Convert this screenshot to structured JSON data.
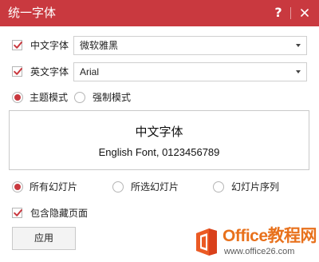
{
  "window": {
    "title": "统一字体",
    "help_label": "?",
    "close_icon": "close-icon"
  },
  "colors": {
    "accent": "#c9393f",
    "watermark_orange": "#e8711c"
  },
  "chinese_font": {
    "checked": true,
    "label": "中文字体",
    "value": "微软雅黑"
  },
  "english_font": {
    "checked": true,
    "label": "英文字体",
    "value": "Arial"
  },
  "mode": {
    "options": [
      {
        "label": "主题模式",
        "checked": true
      },
      {
        "label": "强制模式",
        "checked": false
      }
    ]
  },
  "preview": {
    "chinese_text": "中文字体",
    "english_text": "English Font, 0123456789"
  },
  "scope": {
    "options": [
      {
        "label": "所有幻灯片",
        "checked": true
      },
      {
        "label": "所选幻灯片",
        "checked": false
      },
      {
        "label": "幻灯片序列",
        "checked": false
      }
    ]
  },
  "include_hidden": {
    "checked": true,
    "label": "包含隐藏页面"
  },
  "apply_label": "应用",
  "watermark": {
    "title": "Office教程网",
    "url": "www.office26.com"
  }
}
